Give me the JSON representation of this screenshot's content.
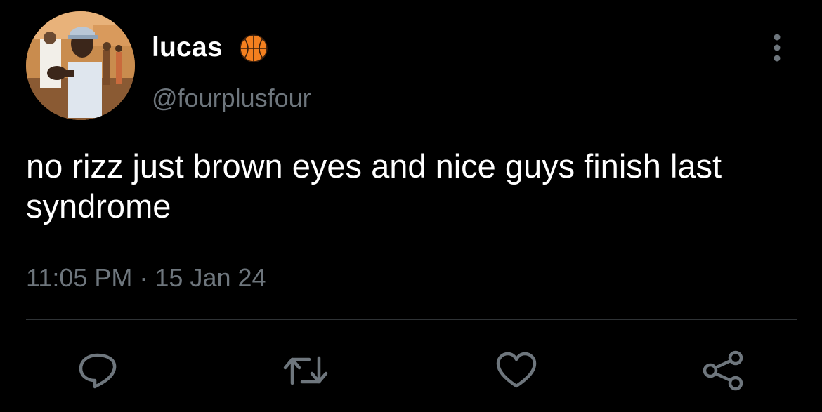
{
  "tweet": {
    "display_name": "lucas",
    "handle": "@fourplusfour",
    "text": "no rizz just brown eyes and nice guys finish last syndrome",
    "timestamp": "11:05 PM · 15 Jan 24",
    "name_emoji": "basketball-icon"
  },
  "actions": {
    "reply": "reply-icon",
    "retweet": "retweet-icon",
    "like": "heart-icon",
    "share": "share-icon",
    "more": "more-vertical-icon"
  },
  "colors": {
    "background": "#000000",
    "primary_text": "#ffffff",
    "secondary_text": "#6e767d",
    "divider": "#2f3336",
    "icon": "#6e767d",
    "basketball": "#f4801f"
  }
}
